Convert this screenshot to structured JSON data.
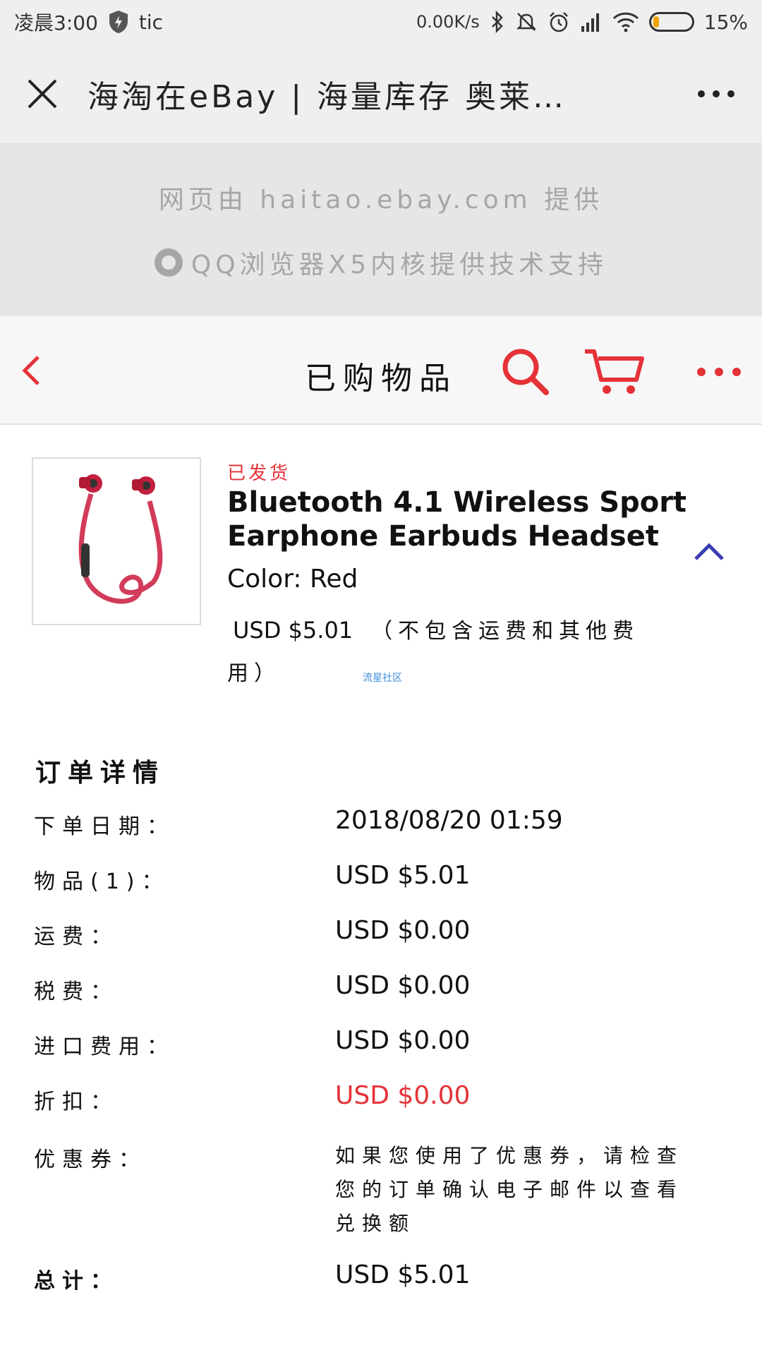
{
  "status_bar": {
    "time": "凌晨3:00",
    "carrier": "tic",
    "network_speed": "0.00K/s",
    "battery": "15%",
    "battery_level": 0.15,
    "battery_color": "#f0a500"
  },
  "browser": {
    "title": "海淘在eBay | 海量库存 奥莱…",
    "provided_by": "网页由 haitao.ebay.com 提供",
    "engine_note": "QQ浏览器X5内核提供技术支持"
  },
  "header": {
    "title": "已购物品",
    "accent_color": "#e53238"
  },
  "product": {
    "status": "已发货",
    "title": "Bluetooth 4.1 Wireless Sport Earphone Earbuds Headset",
    "color_label": "Color:",
    "color_value": "Red",
    "price": "USD $5.01",
    "price_note": "（不包含运费和其他费用）",
    "watermark": "流星社区"
  },
  "order": {
    "heading": "订单详情",
    "rows": [
      {
        "label": "下单日期：",
        "value": "2018/08/20 01:59"
      },
      {
        "label": "物品(1)：",
        "value": "USD $5.01"
      },
      {
        "label": "运费：",
        "value": "USD $0.00"
      },
      {
        "label": "税费：",
        "value": "USD $0.00"
      },
      {
        "label": "进口费用：",
        "value": "USD $0.00"
      },
      {
        "label": "折扣：",
        "value": "USD $0.00"
      },
      {
        "label": "优惠券：",
        "value": "如果您使用了优惠券，请检查您的订单确认电子邮件以查看兑换额"
      },
      {
        "label": "总计：",
        "value": "USD $5.01"
      }
    ]
  },
  "icons": {
    "close": "close-icon",
    "menu": "more-icon",
    "back": "back-chevron-icon",
    "search": "search-icon",
    "cart": "cart-icon",
    "collapse": "chevron-up-icon"
  }
}
